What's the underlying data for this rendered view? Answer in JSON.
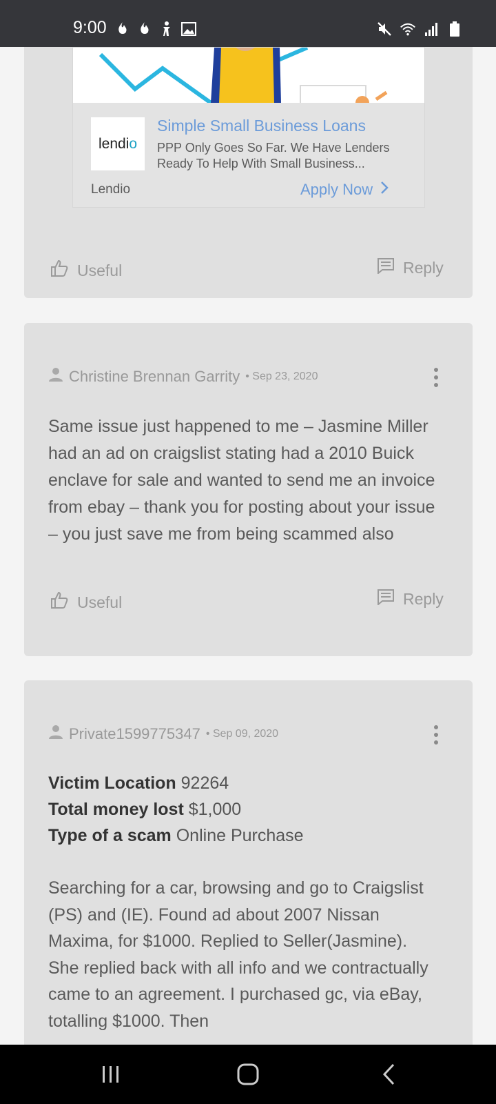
{
  "status_bar": {
    "time": "9:00",
    "left_icons": [
      "flame-icon",
      "flame-icon",
      "accessibility-icon",
      "image-icon"
    ],
    "right_icons": [
      "mute-icon",
      "wifi-icon",
      "signal-icon",
      "battery-icon"
    ]
  },
  "ad": {
    "logo_text": "lendi",
    "logo_accent": "o",
    "title": "Simple Small Business Loans",
    "description": "PPP Only Goes So Far. We Have Lenders Ready To Help With Small Business...",
    "brand": "Lendio",
    "cta": "Apply Now"
  },
  "actions": {
    "useful_label": "Useful",
    "reply_label": "Reply"
  },
  "reviews": [
    {
      "author": "Christine Brennan Garrity",
      "date": "• Sep 23, 2020",
      "text": "Same issue just happened to me – Jasmine Miller had an ad on craigslist stating had a 2010 Buick enclave for sale and wanted to send me an invoice from ebay – thank you for posting about your issue – you just save me from being scammed also"
    },
    {
      "author": "Private1599775347",
      "date": "• Sep 09, 2020",
      "fields": [
        {
          "label": "Victim Location",
          "value": "92264"
        },
        {
          "label": "Total money lost",
          "value": "$1,000"
        },
        {
          "label": "Type of a scam",
          "value": "Online Purchase"
        }
      ],
      "text": "Searching for a car, browsing and go to Craigslist (PS) and (IE). Found ad about 2007 Nissan Maxima, for $1000. Replied to Seller(Jasmine). She replied back with all info and we contractually came to an agreement. I purchased gc, via eBay, totalling $1000. Then"
    }
  ],
  "colors": {
    "status_bar": "#35363a",
    "card": "#e0e0e0",
    "link": "#6b9bd9",
    "page": "#f4f4f4"
  }
}
